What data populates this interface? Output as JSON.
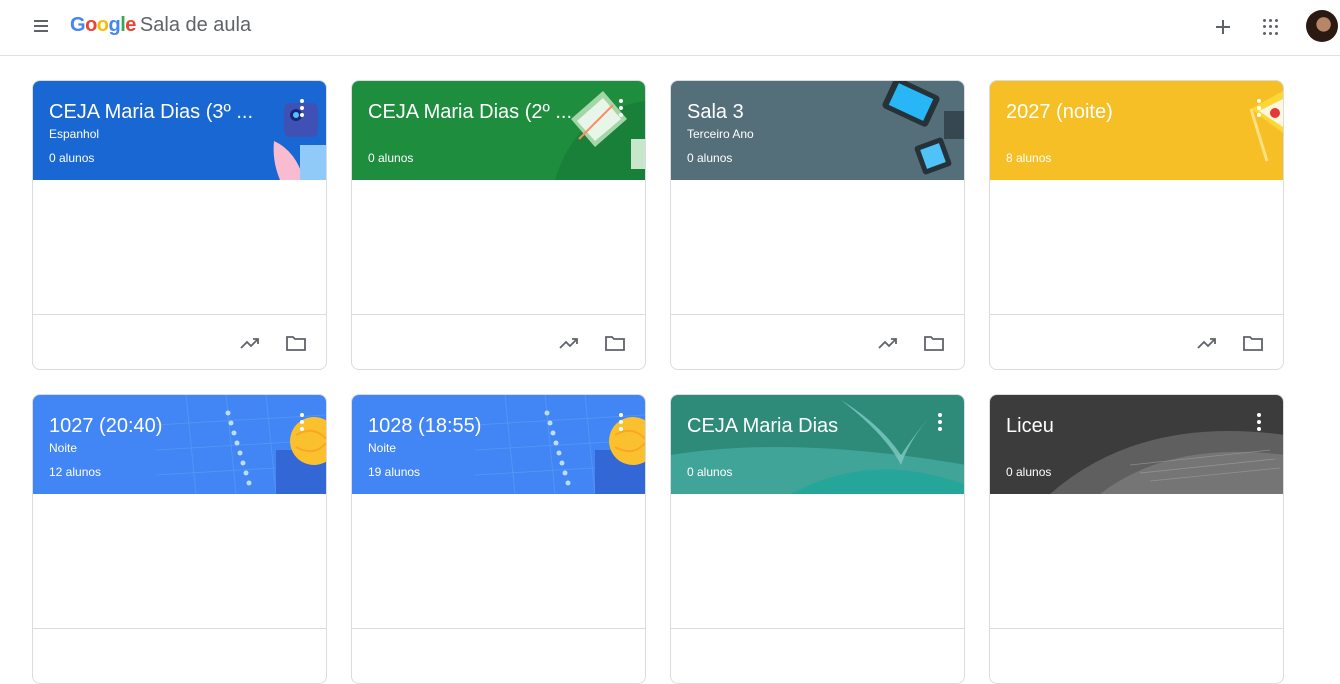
{
  "header": {
    "logo_google": "Google",
    "logo_product": "Sala de aula",
    "menu_icon": "menu-icon",
    "add_icon": "plus-icon",
    "apps_icon": "apps-grid-icon",
    "avatar_icon": "account-avatar"
  },
  "colors": {
    "blue": "#1967d2",
    "green": "#1e8e3e",
    "slate": "#455a64",
    "yellow": "#f9ab00",
    "lightblue": "#4285f4",
    "teal": "#26a69a",
    "dark": "#424242"
  },
  "classes": [
    {
      "title": "CEJA Maria Dias (3º ...",
      "section": "Espanhol",
      "students": "0 alunos"
    },
    {
      "title": "CEJA Maria Dias (2º ...",
      "section": "",
      "students": "0 alunos"
    },
    {
      "title": "Sala 3",
      "section": "Terceiro Ano",
      "students": "0 alunos"
    },
    {
      "title": "2027 (noite)",
      "section": "",
      "students": "8 alunos"
    },
    {
      "title": "1027 (20:40)",
      "section": "Noite",
      "students": "12 alunos"
    },
    {
      "title": "1028 (18:55)",
      "section": "Noite",
      "students": "19 alunos"
    },
    {
      "title": "CEJA Maria Dias",
      "section": "",
      "students": "0 alunos"
    },
    {
      "title": "Liceu",
      "section": "",
      "students": "0 alunos"
    }
  ]
}
